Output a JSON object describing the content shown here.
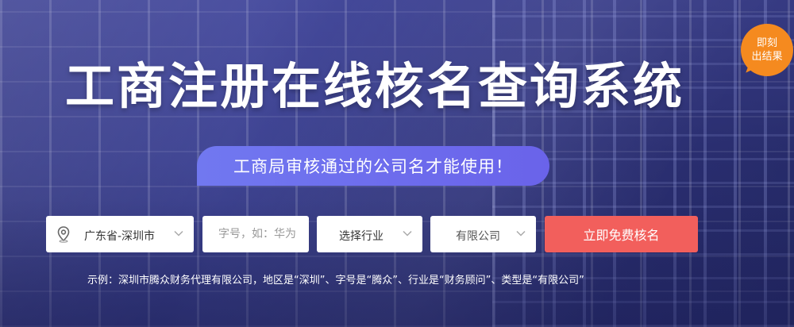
{
  "hero": {
    "title": "工商注册在线核名查询系统",
    "slogan": "工商局审核通过的公司名才能使用！"
  },
  "badge": {
    "line1": "即刻",
    "line2": "出结果"
  },
  "form": {
    "region_value": "广东省-深圳市",
    "name_placeholder": "字号，如：华为",
    "industry_value": "选择行业",
    "type_value": "有限公司",
    "submit_label": "立即免费核名"
  },
  "example_text": "示例：深圳市腾众财务代理有限公司，地区是“深圳”、字号是“腾众”、行业是“财务顾问”、类型是“有限公司”",
  "colors": {
    "accent": "#f25f5c",
    "badge": "#f58a1f",
    "slogan_bg": "#6d6eee"
  },
  "icons": {
    "region": "location-pin-icon",
    "dropdown": "chevron-down-icon"
  }
}
